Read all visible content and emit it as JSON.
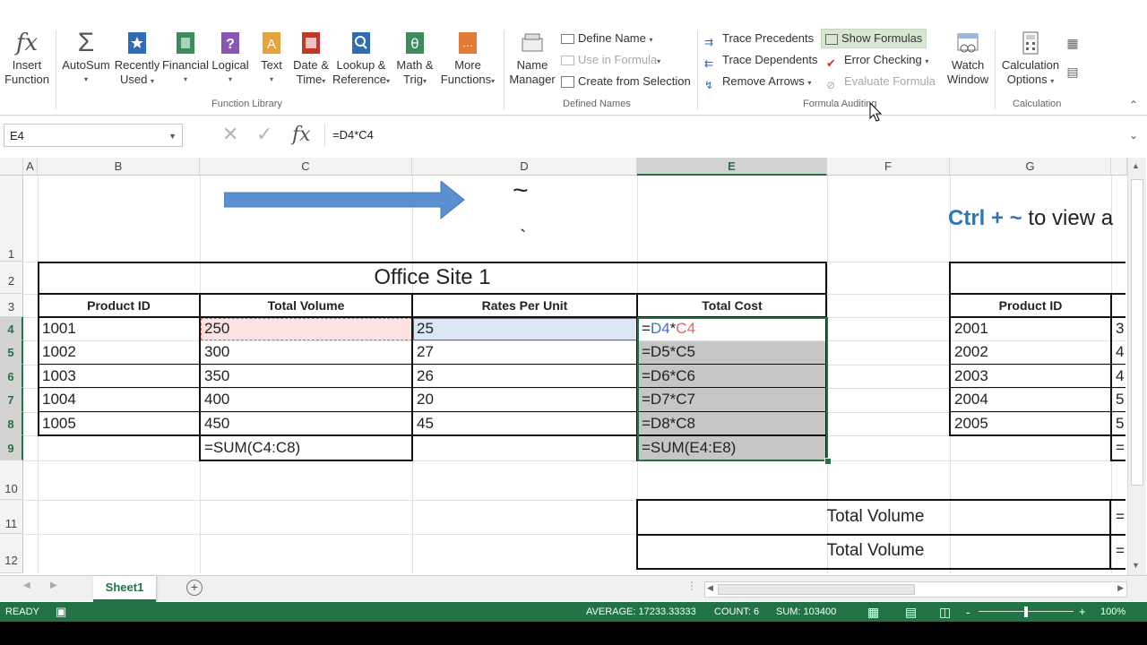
{
  "ribbon": {
    "function_library": {
      "label": "Function Library",
      "insert_function": "Insert\nFunction",
      "insert_function_l1": "Insert",
      "insert_function_l2": "Function",
      "autosum": "AutoSum",
      "recently_used_l1": "Recently",
      "recently_used_l2": "Used",
      "financial": "Financial",
      "logical": "Logical",
      "text": "Text",
      "date_time_l1": "Date &",
      "date_time_l2": "Time",
      "lookup_l1": "Lookup &",
      "lookup_l2": "Reference",
      "math_l1": "Math &",
      "math_l2": "Trig",
      "more_l1": "More",
      "more_l2": "Functions"
    },
    "defined_names": {
      "label": "Defined Names",
      "name_manager_l1": "Name",
      "name_manager_l2": "Manager",
      "define_name": "Define Name",
      "use_in_formula": "Use in Formula",
      "create_from_selection": "Create from Selection"
    },
    "formula_auditing": {
      "label": "Formula Auditing",
      "trace_precedents": "Trace Precedents",
      "trace_dependents": "Trace Dependents",
      "remove_arrows": "Remove Arrows",
      "show_formulas": "Show Formulas",
      "error_checking": "Error Checking",
      "evaluate_formula": "Evaluate Formula",
      "watch_window_l1": "Watch",
      "watch_window_l2": "Window"
    },
    "calculation": {
      "label": "Calculation",
      "options_l1": "Calculation",
      "options_l2": "Options"
    }
  },
  "formula_bar": {
    "name_box": "E4",
    "formula": "=D4*C4",
    "fx": "fx"
  },
  "columns": [
    "A",
    "B",
    "C",
    "D",
    "E",
    "F",
    "G"
  ],
  "rows": [
    "1",
    "2",
    "3",
    "4",
    "5",
    "6",
    "7",
    "8",
    "9",
    "10",
    "11",
    "12"
  ],
  "sheet": {
    "tilde": "~",
    "backtick": "`",
    "hint_ctrl": "Ctrl + ~",
    "hint_rest": " to view a",
    "table1": {
      "title": "Office Site 1",
      "headers": [
        "Product ID",
        "Total Volume",
        "Rates Per Unit",
        "Total Cost"
      ],
      "rows": [
        [
          "1001",
          "250",
          "25",
          "=D4*C4"
        ],
        [
          "1002",
          "300",
          "27",
          "=D5*C5"
        ],
        [
          "1003",
          "350",
          "26",
          "=D6*C6"
        ],
        [
          "1004",
          "400",
          "20",
          "=D7*C7"
        ],
        [
          "1005",
          "450",
          "45",
          "=D8*C8"
        ]
      ],
      "sum_volume": "=SUM(C4:C8)",
      "sum_cost": "=SUM(E4:E8)",
      "e4_ref1": "D4",
      "e4_ref2": "C4"
    },
    "table2": {
      "header": "Product ID",
      "ids": [
        "2001",
        "2002",
        "2003",
        "2004",
        "2005"
      ],
      "partial": [
        "3",
        "4",
        "4",
        "5",
        "5"
      ],
      "partial_eq": "="
    },
    "summary": {
      "row11": "Total Volume",
      "row12": "Total Volume",
      "partial_eq": "="
    }
  },
  "tabs": {
    "sheet1": "Sheet1"
  },
  "status": {
    "mode": "READY",
    "average": "AVERAGE: 17233.33333",
    "count": "COUNT: 6",
    "sum": "SUM: 103400",
    "zoom": "100%",
    "zoom_minus": "-",
    "zoom_plus": "+"
  },
  "colors": {
    "excel_green": "#217346",
    "ref_blue": "#4472c4",
    "ref_red": "#e06666",
    "hint_blue": "#2e75b6",
    "arrow": "#5b8fd0"
  }
}
